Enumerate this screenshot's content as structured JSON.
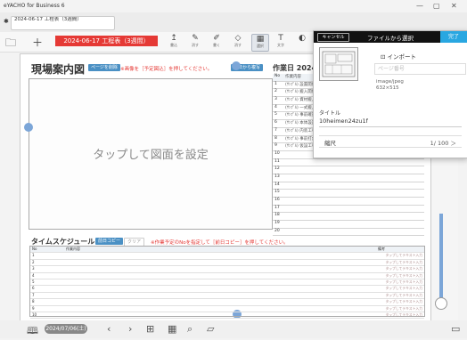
{
  "window": {
    "app_title": "eYACHO for Business 6",
    "minimize": "—",
    "restore": "▢",
    "close": "✕"
  },
  "tab": {
    "label": "2024-06-17 工程表（3週間）",
    "pin": "✱"
  },
  "toolbar": {
    "date_label": "2024-06-17 工程表（3週間）",
    "tools": [
      {
        "icon": "↥",
        "label": "書込"
      },
      {
        "icon": "✎",
        "label": "消す"
      },
      {
        "icon": "✐",
        "label": "書く"
      },
      {
        "icon": "◇",
        "label": "消す"
      },
      {
        "icon": "▦",
        "label": "選択"
      },
      {
        "icon": "T",
        "label": "文字"
      },
      {
        "icon": "◐",
        "label": ""
      }
    ]
  },
  "sheet": {
    "title": "現場案内図",
    "page_delete_button": "ページを削除",
    "note": "※画像を［予定図込］を押してください。",
    "copy_button": "前日から複写",
    "work_title": "作業日 2024/",
    "draw_placeholder": "タップして図面を設定",
    "work_rows": [
      {
        "no": "No",
        "text": "作業内容"
      },
      {
        "no": "1",
        "text": "(ｻﾝﾌﾟﾙ) 設置開始"
      },
      {
        "no": "2",
        "text": "(ｻﾝﾌﾟﾙ) 搬入開始"
      },
      {
        "no": "3",
        "text": "(ｻﾝﾌﾟﾙ) 資材搬入"
      },
      {
        "no": "4",
        "text": "(ｻﾝﾌﾟﾙ) 一式搬入"
      },
      {
        "no": "5",
        "text": "(ｻﾝﾌﾟﾙ) 事前確認"
      },
      {
        "no": "6",
        "text": "(ｻﾝﾌﾟﾙ) 本体設置"
      },
      {
        "no": "7",
        "text": "(ｻﾝﾌﾟﾙ) 内装工事"
      },
      {
        "no": "8",
        "text": "(ｻﾝﾌﾟﾙ) 事前打合"
      },
      {
        "no": "9",
        "text": "(ｻﾝﾌﾟﾙ) 仮設工事"
      },
      {
        "no": "10",
        "text": ""
      },
      {
        "no": "11",
        "text": ""
      },
      {
        "no": "12",
        "text": ""
      },
      {
        "no": "13",
        "text": ""
      },
      {
        "no": "14",
        "text": ""
      },
      {
        "no": "15",
        "text": ""
      },
      {
        "no": "16",
        "text": ""
      },
      {
        "no": "17",
        "text": ""
      },
      {
        "no": "18",
        "text": ""
      },
      {
        "no": "19",
        "text": ""
      },
      {
        "no": "20",
        "text": ""
      }
    ],
    "schedule_title": "タイムスケジュール",
    "schedule_copy": "前日コピー",
    "schedule_clear": "クリア",
    "schedule_note": "※作業予定のNoを指定して［前日コピー］を押してください。",
    "schedule_header_no": "No",
    "schedule_header_task": "作業内容",
    "schedule_header_note": "備考",
    "schedule_rows": [
      {
        "no": "1",
        "note": "タップしてテキスト入力"
      },
      {
        "no": "2",
        "note": "タップしてテキスト入力"
      },
      {
        "no": "3",
        "note": "タップしてテキスト入力"
      },
      {
        "no": "4",
        "note": "タップしてテキスト入力"
      },
      {
        "no": "5",
        "note": "タップしてテキスト入力"
      },
      {
        "no": "6",
        "note": "タップしてテキスト入力"
      },
      {
        "no": "7",
        "note": "タップしてテキスト入力"
      },
      {
        "no": "8",
        "note": "タップしてテキスト入力"
      },
      {
        "no": "9",
        "note": "タップしてテキスト入力"
      },
      {
        "no": "10",
        "note": "タップしてテキスト入力"
      }
    ]
  },
  "statusbar": {
    "date": "2024/07/06(土)"
  },
  "popup": {
    "cancel": "キャンセル",
    "title": "ファイルから選択",
    "done": "完了",
    "import": "⊡ インポート",
    "page_placeholder": "ページ番号",
    "mime": "image/jpeg",
    "dimensions": "632×515",
    "title_label": "タイトル",
    "filename": "10heimen24zu1f",
    "scale_label": "縮尺",
    "scale_value": "1/ 100 ＞"
  }
}
